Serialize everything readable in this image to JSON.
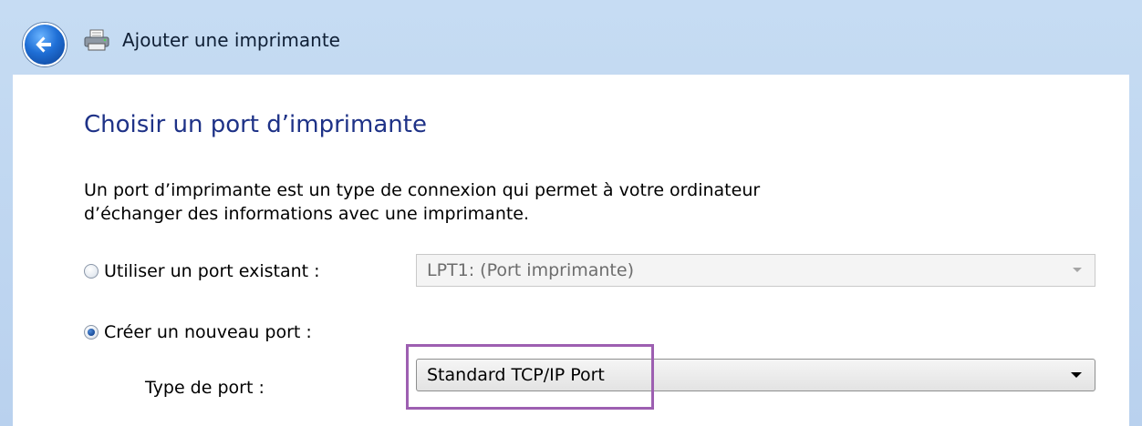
{
  "window": {
    "title": "Ajouter une imprimante",
    "icons": [
      "back-arrow-icon",
      "printer-icon"
    ]
  },
  "page": {
    "heading": "Choisir un port d’imprimante",
    "description": "Un port d’imprimante est un type de connexion qui permet à votre ordinateur d’échanger des informations avec une imprimante."
  },
  "options": {
    "existing": {
      "label": "Utiliser un port existant :",
      "checked": false,
      "value": "LPT1: (Port imprimante)",
      "disabled": true
    },
    "new_port": {
      "label": "Créer un nouveau port :",
      "checked": true,
      "type_label": "Type de port :",
      "value": "Standard TCP/IP Port"
    }
  },
  "colors": {
    "heading": "#1e3287",
    "frame": "#c6dcf3",
    "highlight": "#9d5fb1"
  }
}
